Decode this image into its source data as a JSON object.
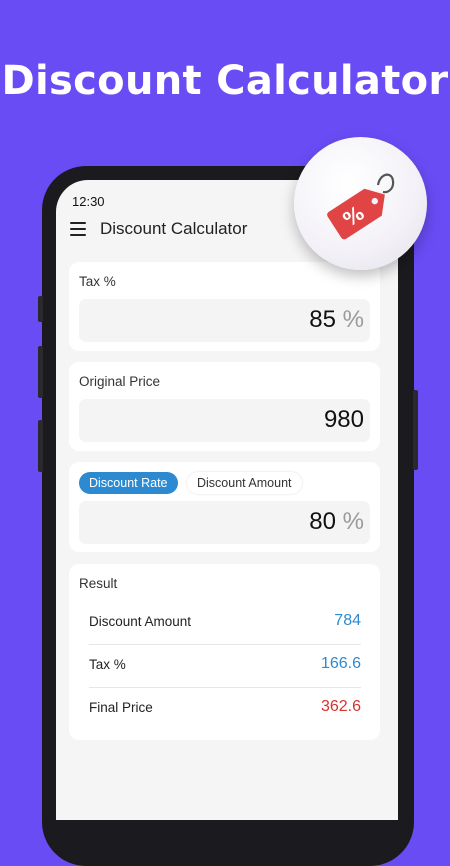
{
  "promo": {
    "title": "Discount Calculator"
  },
  "status_bar": {
    "time": "12:30"
  },
  "appbar": {
    "title": "Discount Calculator",
    "menu_icon": "hamburger-menu-icon"
  },
  "tax_card": {
    "label": "Tax %",
    "value": "85",
    "suffix": "%"
  },
  "original_price_card": {
    "label": "Original Price",
    "value": "980"
  },
  "discount_card": {
    "tabs": [
      {
        "label": "Discount Rate",
        "active": true
      },
      {
        "label": "Discount Amount",
        "active": false
      }
    ],
    "value": "80",
    "suffix": "%"
  },
  "result": {
    "title": "Result",
    "rows": [
      {
        "label": "Discount Amount",
        "value": "784",
        "color": "#2d8ad0"
      },
      {
        "label": "Tax %",
        "value": "166.6",
        "color": "#2d8ad0"
      },
      {
        "label": "Final Price",
        "value": "362.6",
        "color": "#d8312c"
      }
    ]
  },
  "badge": {
    "icon": "price-tag-percent-icon",
    "color": "#e04444"
  }
}
